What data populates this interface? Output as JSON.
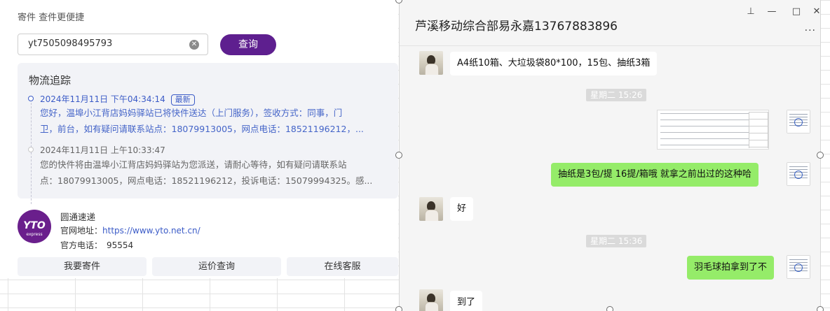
{
  "left": {
    "header": "寄件 查件更便捷",
    "search": {
      "value": "yt7505098495793",
      "button": "查询"
    },
    "logistics": {
      "title": "物流追踪",
      "events": [
        {
          "time": "2024年11月11日 下午04:34:14",
          "badge": "最新",
          "line1": "您好，温埠小江背店妈妈驿站已将快件送达（上门服务），签收方式：同事，门",
          "line2": "卫，前台，如有疑问请联系站点：18079913005，网点电话：18521196212，..."
        },
        {
          "time": "2024年11月11日 上午10:33:47",
          "line1": "您的快件将由温埠小江背店妈妈驿站为您派送，请耐心等待，如有疑问请联系站",
          "line2": "点：18079913005，网点电话：18521196212，投诉电话：15079994325。感..."
        }
      ]
    },
    "company": {
      "logo_text": "YTO",
      "logo_sub": "express",
      "name": "圆通速递",
      "site_label": "官网地址：",
      "site_url": "https://www.yto.net.cn/",
      "phone_label": "官方电话：",
      "phone": "95554"
    },
    "actions": [
      "我要寄件",
      "运价查询",
      "在线客服"
    ]
  },
  "chat": {
    "title": "芦溪移动综合部易永嘉13767883896",
    "window_controls": {
      "pin": "⊥",
      "minimize": "—",
      "maximize": "□",
      "close": "✕"
    },
    "more": "···",
    "messages": [
      {
        "dir": "in",
        "text": "A4纸10箱、大垃圾袋80*100，15包、抽纸3箱"
      },
      {
        "type": "time",
        "text": "星期二 15:26"
      },
      {
        "dir": "out",
        "type": "image",
        "text": ""
      },
      {
        "dir": "out",
        "text": "抽纸是3包/提  16提/箱哦  就拿之前出过的这种哈"
      },
      {
        "dir": "in",
        "text": "好"
      },
      {
        "type": "time",
        "text": "星期二 15:36"
      },
      {
        "dir": "out",
        "text": "羽毛球拍拿到了不"
      },
      {
        "dir": "in",
        "text": "到了"
      }
    ]
  },
  "colors": {
    "brand": "#5e1f8f",
    "link": "#3b5bc7",
    "bubble_out": "#95ec69"
  }
}
